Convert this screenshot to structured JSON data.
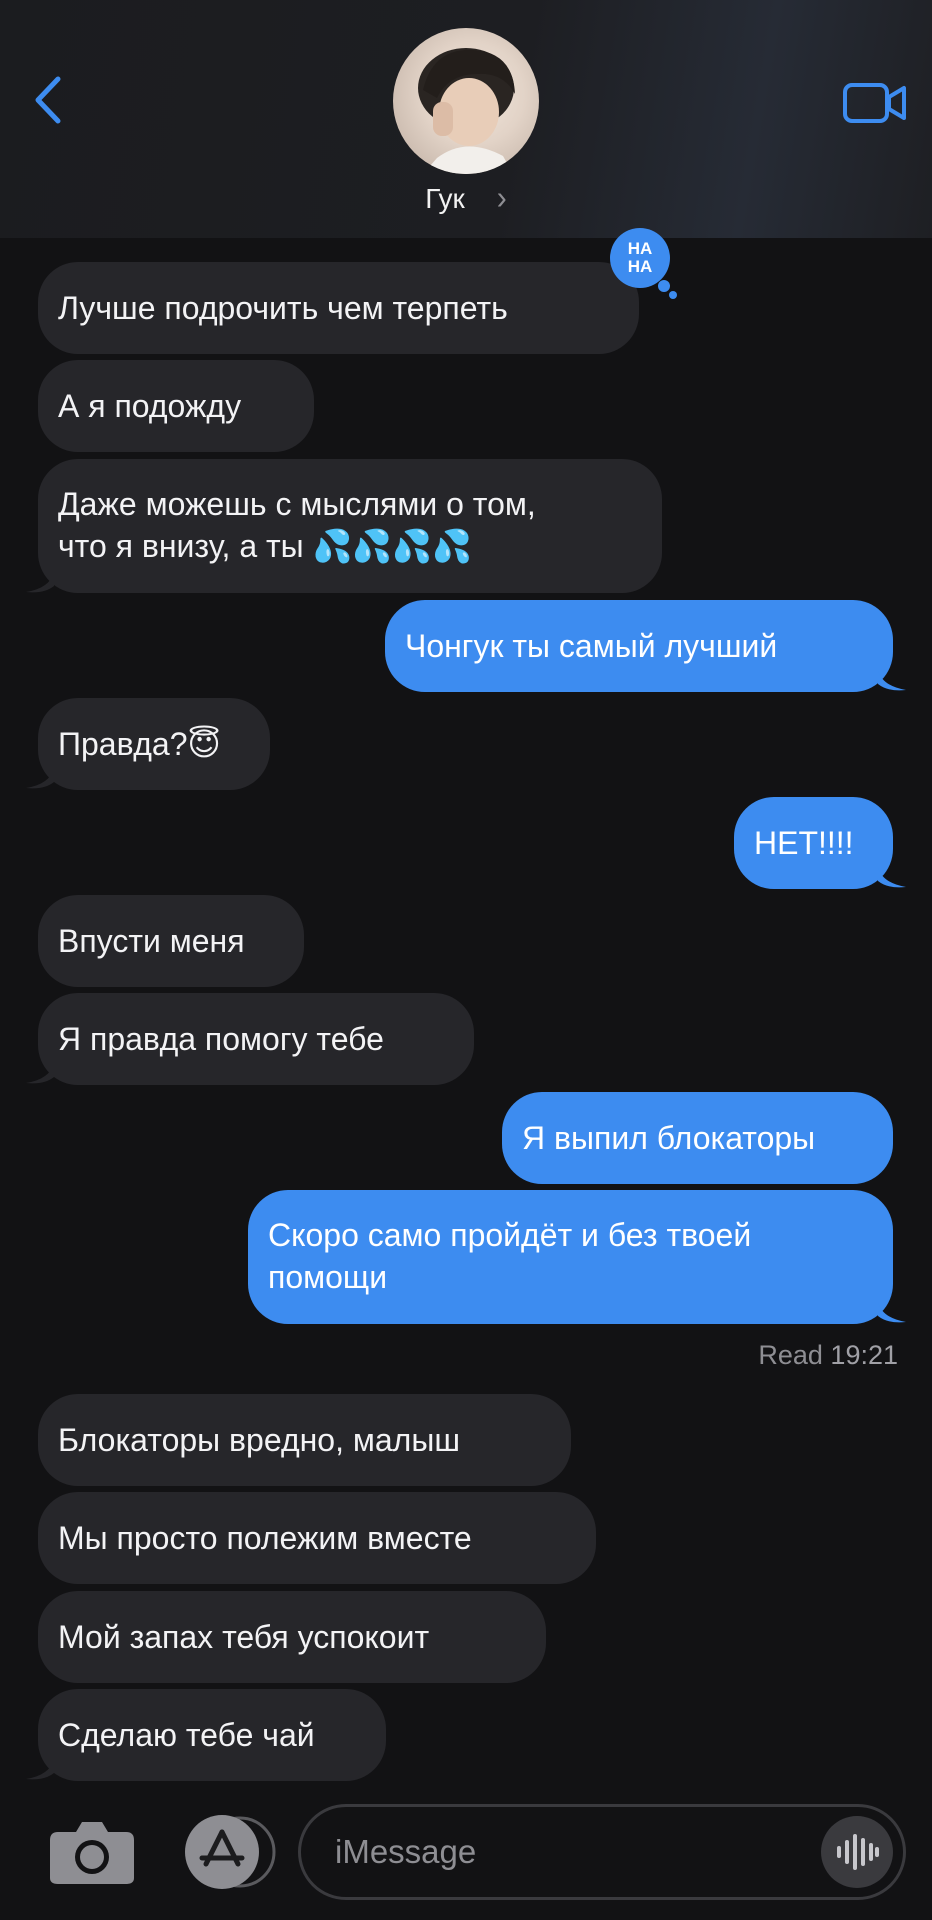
{
  "header": {
    "contact_name": "Гук",
    "chevron": "›"
  },
  "messages": [
    {
      "side": "in",
      "text": "Лучше подрочить чем терпеть"
    },
    {
      "side": "in",
      "text": "А я подожду"
    },
    {
      "side": "in",
      "text_line1": "Даже можешь с мыслями о том,",
      "text_line2": "что я внизу,  а ты 💦💦💦💦"
    },
    {
      "side": "out",
      "text": "Чонгук ты самый лучший"
    },
    {
      "side": "in",
      "text": "Правда?😇"
    },
    {
      "side": "out",
      "text": "НЕТ!!!!"
    },
    {
      "side": "in",
      "text": "Впусти меня"
    },
    {
      "side": "in",
      "text": "Я правда помогу тебе"
    },
    {
      "side": "out",
      "text": "Я выпил блокаторы"
    },
    {
      "side": "out",
      "text_line1": "Скоро само пройдёт  и без твоей",
      "text_line2": "помощи"
    },
    {
      "side": "in",
      "text": "Блокаторы вредно,  малыш"
    },
    {
      "side": "in",
      "text": "Мы просто полежим вместе"
    },
    {
      "side": "in",
      "text": "Мой запах тебя успокоит"
    },
    {
      "side": "in",
      "text": "Сделаю тебе чай"
    }
  ],
  "tapback": {
    "line1": "HA",
    "line2": "HA"
  },
  "read_receipt": {
    "label": "Read",
    "time": "19:21"
  },
  "input": {
    "placeholder": "iMessage"
  },
  "colors": {
    "accent": "#3d8cf0",
    "incoming_bubble": "#26262a",
    "background": "#121214"
  },
  "icons": [
    "back-chevron-icon",
    "video-camera-icon",
    "camera-icon",
    "app-store-icon",
    "voice-waveform-icon"
  ]
}
